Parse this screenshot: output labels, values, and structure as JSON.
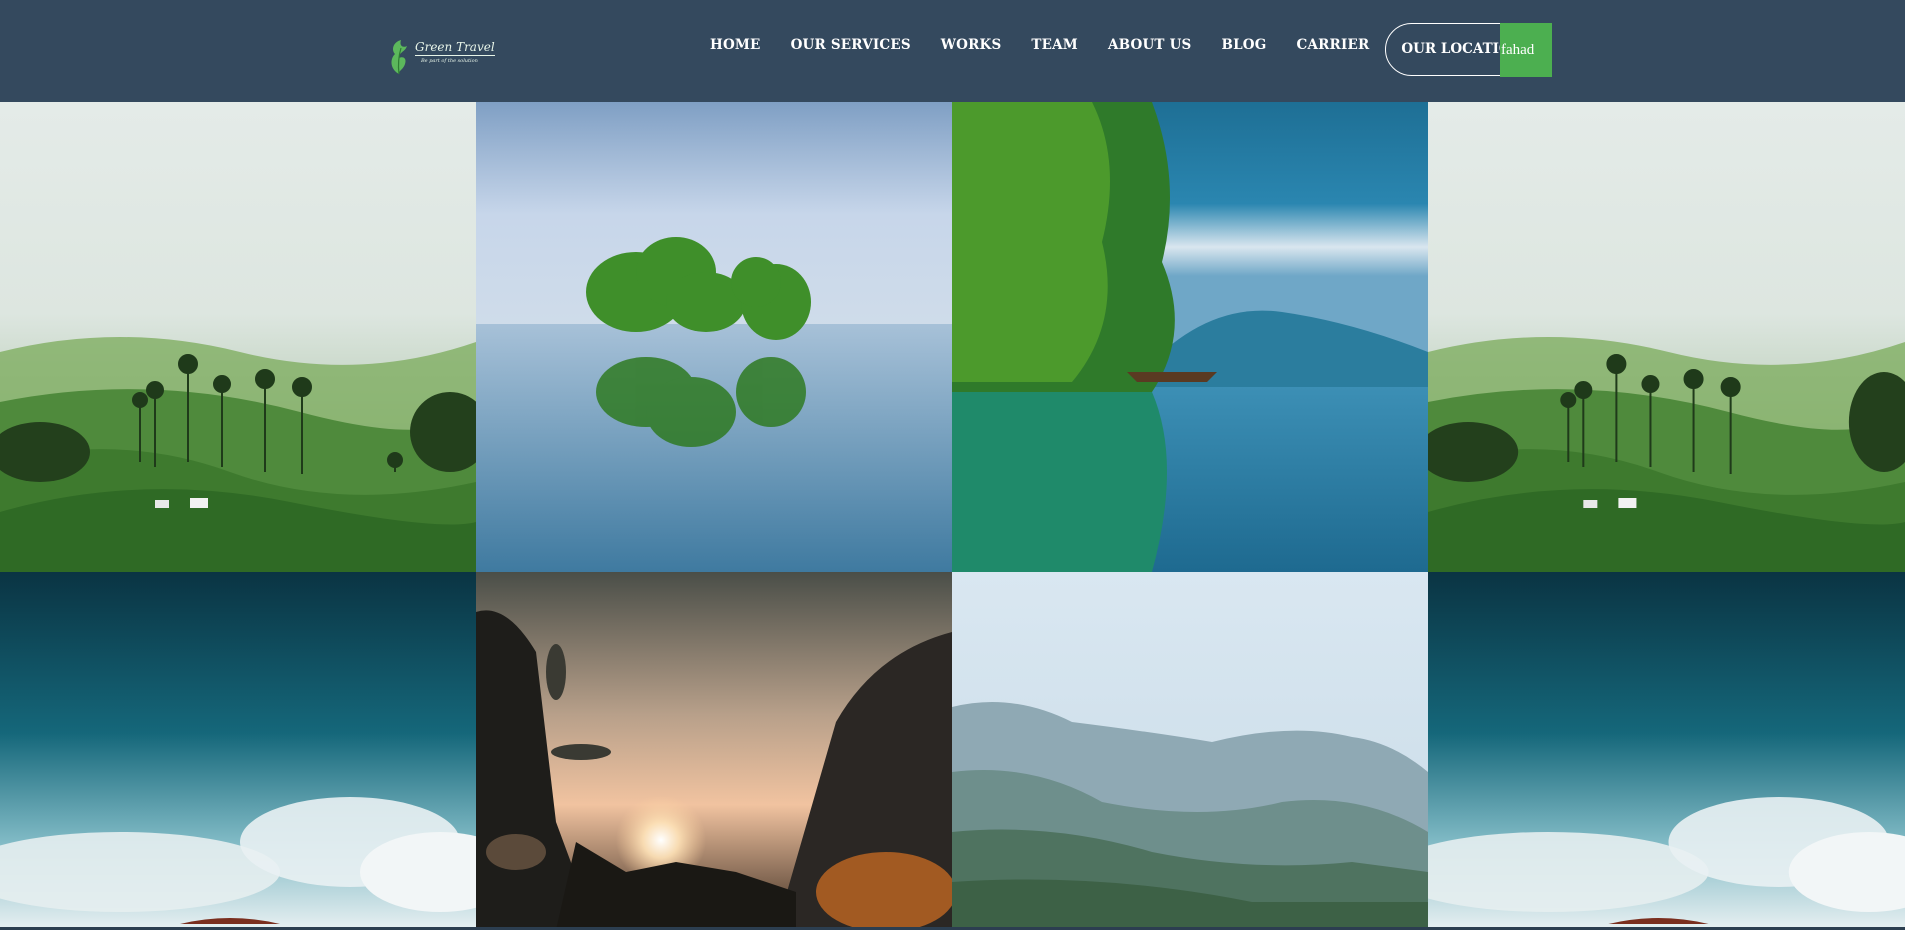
{
  "brand": {
    "name": "Green Travel",
    "tagline": "Be part of the solution",
    "accent_color": "#4caf50",
    "header_color": "#34495e"
  },
  "nav": {
    "items": [
      {
        "label": "HOME"
      },
      {
        "label": "OUR SERVICES"
      },
      {
        "label": "WORKS"
      },
      {
        "label": "TEAM"
      },
      {
        "label": "ABOUT US"
      },
      {
        "label": "BLOG"
      },
      {
        "label": "CARRIER"
      }
    ],
    "cta_label": "OUR LOCATION",
    "user_label": "fahad"
  },
  "gallery": {
    "photos": [
      {
        "subject": "misty green hills with palm trees"
      },
      {
        "subject": "trees standing in calm lake with reflection"
      },
      {
        "subject": "jungle cliff over turquoise lake with boat"
      },
      {
        "subject": "misty green hills with palm trees"
      },
      {
        "subject": "dark teal sky above clouds"
      },
      {
        "subject": "sunset through dark forest silhouettes"
      },
      {
        "subject": "hazy forested mountain ridge"
      },
      {
        "subject": "dark teal sky above clouds"
      }
    ]
  }
}
